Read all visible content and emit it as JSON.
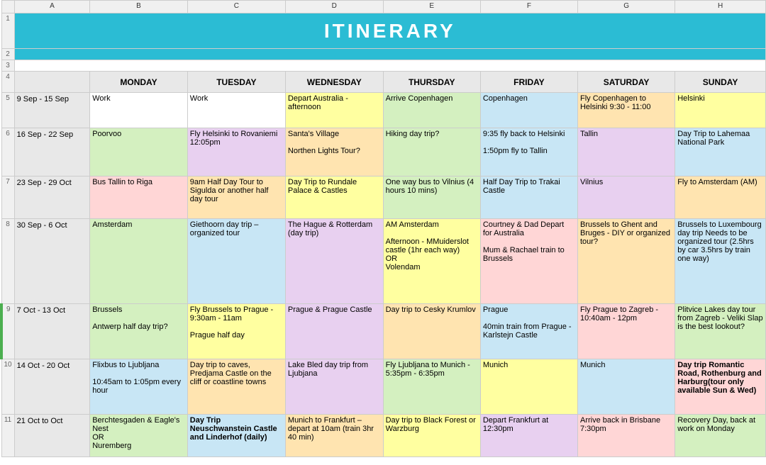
{
  "title": "ITINERARY",
  "col_letters": [
    "",
    "A",
    "B",
    "C",
    "D",
    "E",
    "F",
    "G",
    "H"
  ],
  "day_headers": [
    "MONDAY",
    "TUESDAY",
    "WEDNESDAY",
    "THURSDAY",
    "FRIDAY",
    "SATURDAY",
    "SUNDAY"
  ],
  "weeks": [
    {
      "row_num": "5",
      "dates": "9 Sep - 15 Sep",
      "monday": {
        "text": "Work",
        "color": "white-cell"
      },
      "tuesday": {
        "text": "Work",
        "color": "white-cell"
      },
      "wednesday": {
        "text": "Depart Australia - afternoon",
        "color": "yellow"
      },
      "thursday": {
        "text": "Arrive Copenhagen",
        "color": "light-green"
      },
      "friday": {
        "text": "Copenhagen",
        "color": "light-blue"
      },
      "saturday": {
        "text": "Fly Copenhagen to Helsinki 9:30 - 11:00",
        "color": "peach"
      },
      "sunday": {
        "text": "Helsinki",
        "color": "yellow"
      }
    },
    {
      "row_num": "6",
      "dates": "16 Sep - 22 Sep",
      "monday": {
        "text": "Poorvoo",
        "color": "light-green"
      },
      "tuesday": {
        "text": "Fly Helsinki to Rovaniemi 12:05pm",
        "color": "light-purple"
      },
      "wednesday": {
        "text": "Santa's Village\n\nNorthen Lights Tour?",
        "color": "peach"
      },
      "thursday": {
        "text": "Hiking day trip?",
        "color": "light-green"
      },
      "friday": {
        "text": "9:35 fly back to Helsinki\n\n1:50pm fly to Tallin",
        "color": "light-blue"
      },
      "saturday": {
        "text": "Tallin",
        "color": "light-purple"
      },
      "sunday": {
        "text": "Day Trip to Lahemaa National Park",
        "color": "light-blue"
      }
    },
    {
      "row_num": "7",
      "dates": "23 Sep - 29 Oct",
      "monday": {
        "text": "Bus Tallin to Riga",
        "color": "pink"
      },
      "tuesday": {
        "text": "9am Half Day Tour to Sigulda or another half day tour",
        "color": "peach"
      },
      "wednesday": {
        "text": "Day Trip to Rundale Palace & Castles",
        "color": "yellow"
      },
      "thursday": {
        "text": "One way bus to Vilnius (4 hours 10 mins)",
        "color": "light-green"
      },
      "friday": {
        "text": "Half Day Trip to Trakai Castle",
        "color": "light-blue"
      },
      "saturday": {
        "text": "Vilnius",
        "color": "light-purple"
      },
      "sunday": {
        "text": "Fly to Amsterdam (AM)",
        "color": "peach"
      }
    },
    {
      "row_num": "8",
      "dates": "30 Sep - 6 Oct",
      "monday": {
        "text": "Amsterdam",
        "color": "light-green"
      },
      "tuesday": {
        "text": "Giethoorn day trip – organized tour",
        "color": "light-blue"
      },
      "wednesday": {
        "text": "The Hague & Rotterdam (day trip)",
        "color": "light-purple"
      },
      "thursday": {
        "text": "AM Amsterdam\n\nAfternoon - MMuiderslot castle (1hr each way)\nOR\nVolendam",
        "color": "yellow"
      },
      "friday": {
        "text": "Courtney & Dad Depart for Australia\n\nMum & Rachael train to Brussels",
        "color": "pink"
      },
      "saturday": {
        "text": "Brussels to Ghent and Bruges - DIY or organized tour?",
        "color": "peach"
      },
      "sunday": {
        "text": "Brussels to Luxembourg day trip Needs to be organized tour (2.5hrs by car 3.5hrs by train one way)",
        "color": "light-blue"
      }
    },
    {
      "row_num": "9",
      "dates": "7 Oct - 13 Oct",
      "monday": {
        "text": "Brussels\n\nAntwerp half day trip?",
        "color": "light-green"
      },
      "tuesday": {
        "text": "Fly Brussels to Prague - 9:30am - 11am\n\nPrague half day",
        "color": "yellow"
      },
      "wednesday": {
        "text": "Prague & Prague Castle",
        "color": "light-purple"
      },
      "thursday": {
        "text": "Day trip to Cesky Krumlov",
        "color": "peach"
      },
      "friday": {
        "text": "Prague\n\n40min train from Prague - Karlstejn Castle",
        "color": "light-blue"
      },
      "saturday": {
        "text": "Fly Prague to Zagreb - 10:40am - 12pm",
        "color": "pink"
      },
      "sunday": {
        "text": "Plitvice Lakes day tour from Zagreb - Veliki Slap is the best lookout?",
        "color": "light-green"
      }
    },
    {
      "row_num": "10",
      "dates": "14 Oct - 20 Oct",
      "monday": {
        "text": "Flixbus to Ljubljana\n\n10:45am to 1:05pm every hour",
        "color": "light-blue"
      },
      "tuesday": {
        "text": "Day trip to caves, Predjama Castle on the cliff or coastline towns",
        "color": "peach"
      },
      "wednesday": {
        "text": "Lake Bled day trip from Ljubjana",
        "color": "light-purple"
      },
      "thursday": {
        "text": "Fly Ljubljana to Munich - 5:35pm - 6:35pm",
        "color": "light-green"
      },
      "friday": {
        "text": "Munich",
        "color": "yellow"
      },
      "saturday": {
        "text": "Munich",
        "color": "light-blue"
      },
      "sunday": {
        "text": "Day trip Romantic Road, Rothenburg and Harburg(tour only available Sun & Wed)",
        "bold": true,
        "color": "pink"
      }
    },
    {
      "row_num": "11",
      "dates": "21 Oct to Oct",
      "monday": {
        "text": "Berchtesgaden & Eagle's Nest\nOR\nNuremberg",
        "color": "light-green"
      },
      "tuesday": {
        "text": "Day Trip Neuschwanstein Castle and Linderhof (daily)",
        "bold": true,
        "color": "light-blue"
      },
      "wednesday": {
        "text": "Munich to Frankfurt – depart at 10am (train 3hr 40 min)",
        "color": "peach"
      },
      "thursday": {
        "text": "Day trip to Black Forest or Warzburg",
        "color": "yellow"
      },
      "friday": {
        "text": "Depart Frankfurt at 12:30pm",
        "color": "light-purple"
      },
      "saturday": {
        "text": "Arrive back in Brisbane 7:30pm",
        "color": "pink"
      },
      "sunday": {
        "text": "Recovery Day, back at work on Monday",
        "color": "light-green"
      }
    }
  ]
}
